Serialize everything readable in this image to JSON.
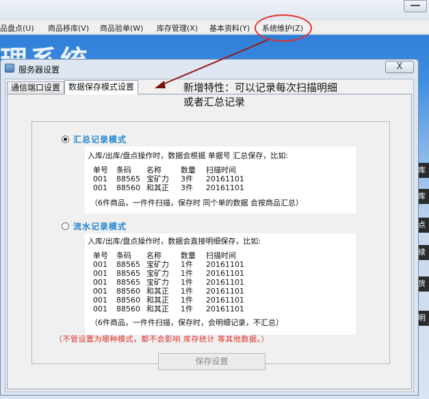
{
  "menu": {
    "items": [
      "品盘点(U)",
      "商品移库(V)",
      "商品验单(W)",
      "库存管理(X)",
      "基本资料(Y)",
      "系统维护(Z)"
    ]
  },
  "background": {
    "title": "理系统",
    "side_tabs": [
      "库时",
      "库时",
      "点时",
      "续时",
      "货盘",
      "明细"
    ]
  },
  "annotation": {
    "note_line1": "新增特性：可以记录每次扫描明细",
    "note_line2": "或者汇总记录",
    "color": "#e0302a"
  },
  "dialog": {
    "title": "服务器设置",
    "close_label": "X",
    "tabs": [
      "通信端口设置",
      "数据保存模式设置"
    ],
    "active_tab": 1,
    "modes": [
      {
        "label": "汇总记录模式",
        "selected": true,
        "description": "入库/出库/盘点操作时，数据会根据 单据号 汇总保存，比如:",
        "headers": [
          "单号",
          "条码",
          "名称",
          "数量",
          "扫描时间"
        ],
        "rows": [
          [
            "001",
            "88565",
            "宝矿力",
            "3件",
            "20161101"
          ],
          [
            "001",
            "88560",
            "和其正",
            "3件",
            "20161101"
          ]
        ],
        "footnote": "（6件商品，一件件扫描，保存时 同个单的数据 会按商品汇总）"
      },
      {
        "label": "流水记录模式",
        "selected": false,
        "description": "入库/出库/盘点操作时，数据会直接明细保存，比如:",
        "headers": [
          "单号",
          "条码",
          "名称",
          "数量",
          "扫描时间"
        ],
        "rows": [
          [
            "001",
            "88565",
            "宝矿力",
            "1件",
            "20161101"
          ],
          [
            "001",
            "88565",
            "宝矿力",
            "1件",
            "20161101"
          ],
          [
            "001",
            "88565",
            "宝矿力",
            "1件",
            "20161101"
          ],
          [
            "001",
            "88560",
            "和其正",
            "1件",
            "20161101"
          ],
          [
            "001",
            "88560",
            "和其正",
            "1件",
            "20161101"
          ],
          [
            "001",
            "88560",
            "和其正",
            "1件",
            "20161101"
          ]
        ],
        "footnote": "（6件商品，一件件扫描，保存时，会明细记录，不汇总）"
      }
    ],
    "warning": "（不管设置为哪种模式，都不会影响 库存统计 等其他数据。）",
    "save_label": "保存设置",
    "accent_color": "#1f84d3"
  }
}
